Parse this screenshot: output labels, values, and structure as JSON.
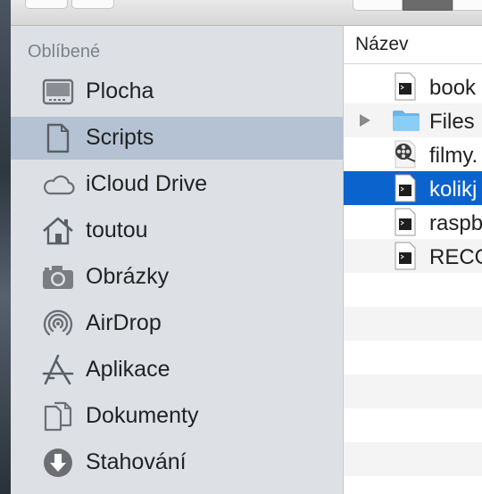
{
  "sidebar": {
    "section_title": "Oblíbené",
    "items": [
      {
        "label": "Plocha",
        "icon": "desktop-icon",
        "selected": false
      },
      {
        "label": "Scripts",
        "icon": "document-icon",
        "selected": true
      },
      {
        "label": "iCloud Drive",
        "icon": "cloud-icon",
        "selected": false
      },
      {
        "label": "toutou",
        "icon": "home-icon",
        "selected": false
      },
      {
        "label": "Obrázky",
        "icon": "camera-icon",
        "selected": false
      },
      {
        "label": "AirDrop",
        "icon": "airdrop-icon",
        "selected": false
      },
      {
        "label": "Aplikace",
        "icon": "applications-icon",
        "selected": false
      },
      {
        "label": "Dokumenty",
        "icon": "documents-icon",
        "selected": false
      },
      {
        "label": "Stahování",
        "icon": "download-icon",
        "selected": false
      }
    ]
  },
  "filelist": {
    "column_name": "Název",
    "rows": [
      {
        "name": "book",
        "icon": "terminal-file-icon"
      },
      {
        "name": "Files",
        "icon": "folder-icon"
      },
      {
        "name": "filmy.",
        "icon": "movie-reel-icon"
      },
      {
        "name": "kolikj",
        "icon": "terminal-file-icon"
      },
      {
        "name": "raspb",
        "icon": "terminal-file-icon"
      },
      {
        "name": "RECO",
        "icon": "terminal-file-icon"
      }
    ]
  },
  "colors": {
    "sidebar_bg": "#dde1e6",
    "sidebar_selected": "#b4c2d3",
    "row_selected": "#0b63ce"
  }
}
